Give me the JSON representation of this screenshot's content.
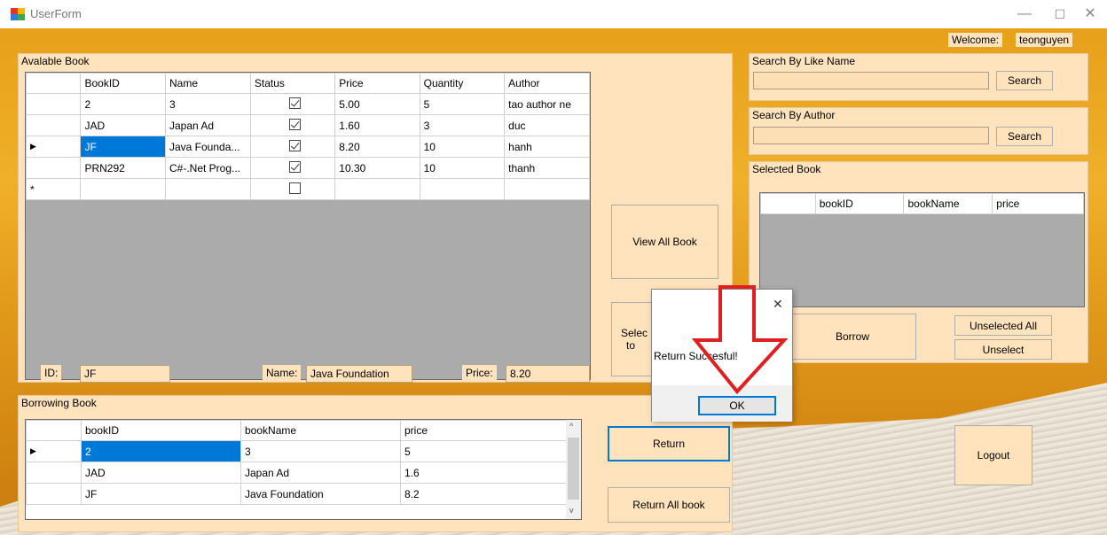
{
  "window": {
    "title": "UserForm",
    "minimize": "—",
    "maximize": "☐",
    "close": "✕"
  },
  "welcome": {
    "label": "Welcome:",
    "user": "teonguyen"
  },
  "available": {
    "label": "Avalable Book",
    "headers": [
      "BookID",
      "Name",
      "Status",
      "Price",
      "Quantity",
      "Author"
    ],
    "rows": [
      {
        "id": "2",
        "name": "3",
        "status": true,
        "price": "5.00",
        "qty": "5",
        "author": "tao author ne"
      },
      {
        "id": "JAD",
        "name": "Japan Ad",
        "status": true,
        "price": "1.60",
        "qty": "3",
        "author": "duc"
      },
      {
        "id": "JF",
        "name": "Java Founda...",
        "status": true,
        "price": "8.20",
        "qty": "10",
        "author": "hanh"
      },
      {
        "id": "PRN292",
        "name": "C#-.Net Prog...",
        "status": true,
        "price": "10.30",
        "qty": "10",
        "author": "thanh"
      }
    ],
    "current_marker": "▶",
    "new_marker": "*"
  },
  "details": {
    "id_label": "ID:",
    "id_value": "JF",
    "name_label": "Name:",
    "name_value": "Java Foundation",
    "price_label": "Price:",
    "price_value": "8.20"
  },
  "borrowing": {
    "label": "Borrowing Book",
    "headers": [
      "bookID",
      "bookName",
      "price"
    ],
    "rows": [
      {
        "id": "2",
        "name": "3",
        "price": "5"
      },
      {
        "id": "JAD",
        "name": "Japan Ad",
        "price": "1.6"
      },
      {
        "id": "JF",
        "name": "Java Foundation",
        "price": "8.2"
      }
    ]
  },
  "buttons": {
    "view_all": "View All Book",
    "select_partial_1": "Selec",
    "select_partial_2": "to",
    "return": "Return",
    "return_all": "Return All book",
    "borrow": "Borrow",
    "unselected_all": "Unselected All",
    "unselect": "Unselect",
    "logout": "Logout",
    "search_name": "Search",
    "search_author": "Search"
  },
  "search_name": {
    "label": "Search By Like Name",
    "value": ""
  },
  "search_author": {
    "label": "Search By Author",
    "value": ""
  },
  "selected": {
    "label": "Selected Book",
    "headers": [
      "bookID",
      "bookName",
      "price"
    ]
  },
  "dialog": {
    "message": "Return Succesful!",
    "ok": "OK",
    "close": "✕"
  },
  "colors": {
    "accent": "#0078d7",
    "panel": "#ffe3bd",
    "annotation_arrow": "#e02020"
  }
}
